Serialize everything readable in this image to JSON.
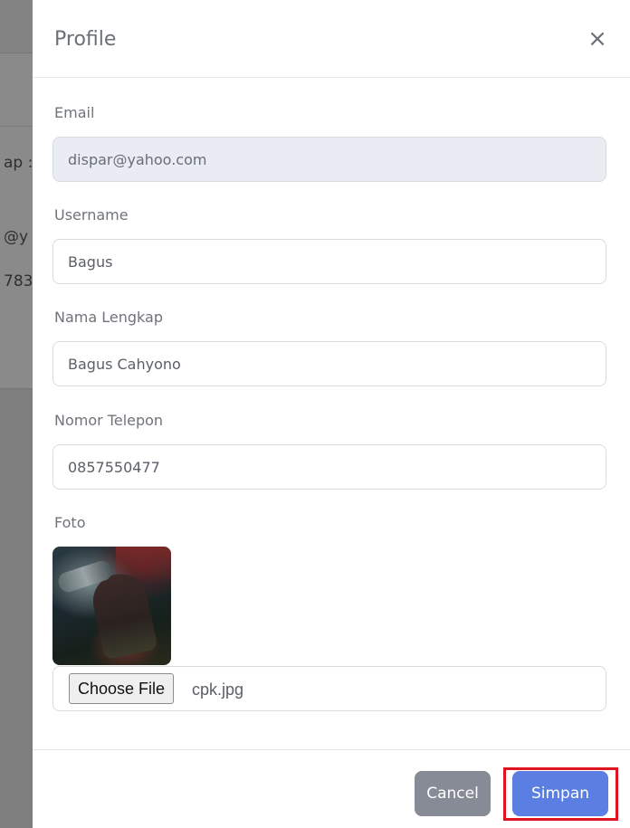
{
  "backdrop": {
    "peek_1": "ap :",
    "peek_2": "@y",
    "peek_3": "783"
  },
  "modal": {
    "title": "Profile",
    "close_icon": "×"
  },
  "form": {
    "email": {
      "label": "Email",
      "value": "dispar@yahoo.com",
      "readonly": true
    },
    "username": {
      "label": "Username",
      "value": "Bagus"
    },
    "full_name": {
      "label": "Nama Lengkap",
      "value": "Bagus Cahyono"
    },
    "phone": {
      "label": "Nomor Telepon",
      "value": "0857550477"
    },
    "photo": {
      "label": "Foto",
      "choose_button_label": "Choose File",
      "file_name": "cpk.jpg"
    }
  },
  "footer": {
    "cancel_label": "Cancel",
    "save_label": "Simpan",
    "highlight_color": "#e0141e"
  },
  "colors": {
    "primary": "#5a7ee2",
    "secondary": "#878b95",
    "readonly_bg": "#e9ecf2"
  }
}
